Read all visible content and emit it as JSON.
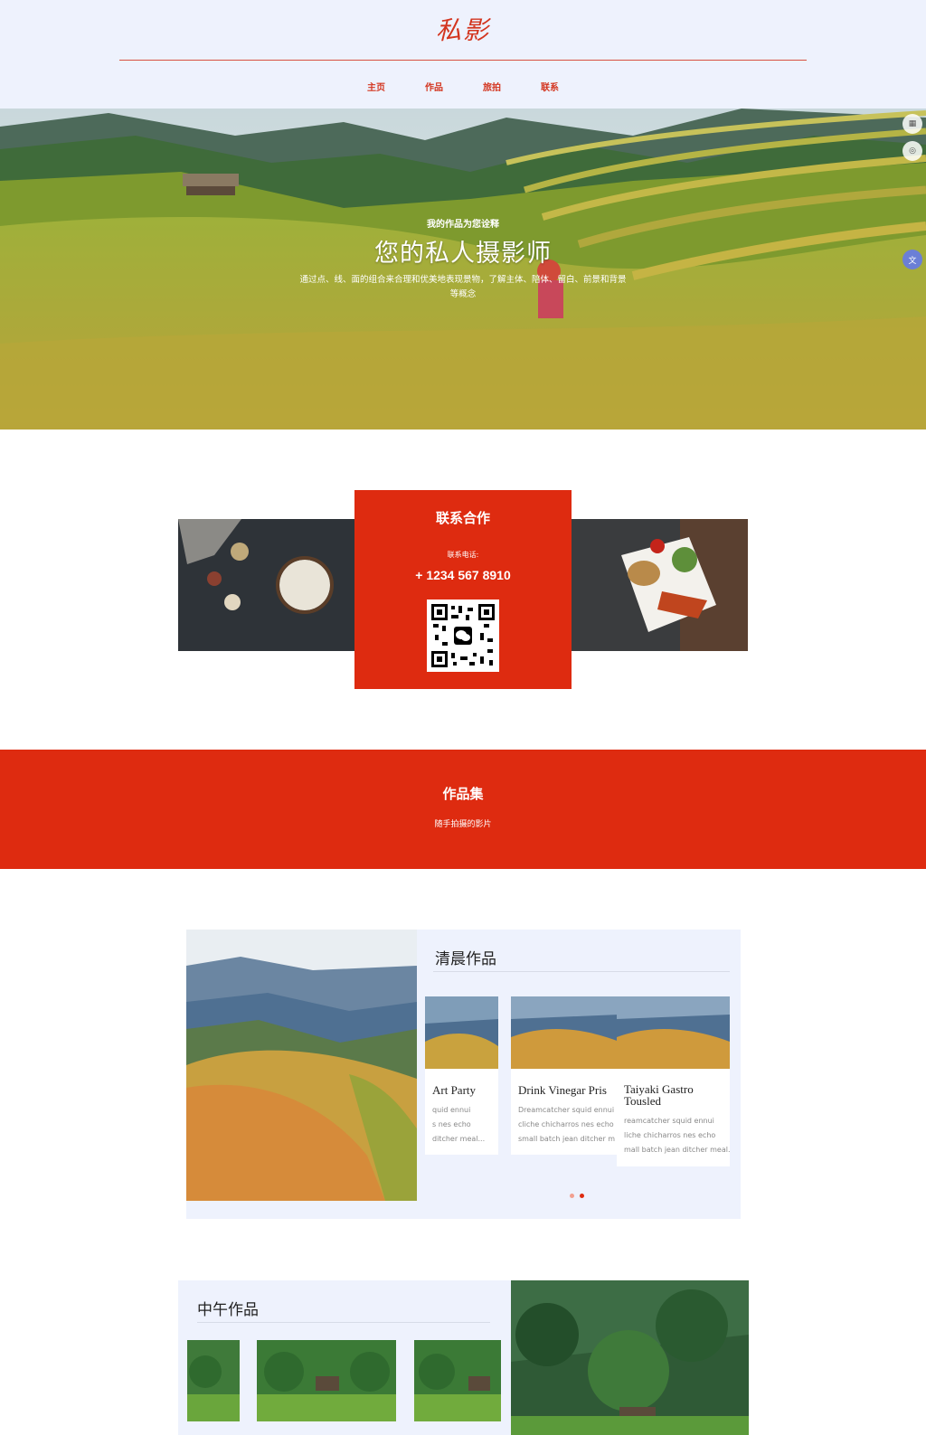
{
  "brand": "私影",
  "nav": [
    "主页",
    "作品",
    "旅拍",
    "联系"
  ],
  "hero": {
    "kicker": "我的作品为您诠释",
    "title": "您的私人摄影师",
    "description": "通过点、线、面的组合来合理和优美地表现景物，了解主体、陪体、留白、前景和背景等概念"
  },
  "contact": {
    "title": "联系合作",
    "phone_label": "联系电话:",
    "phone": "+ 1234 567 8910"
  },
  "works": {
    "title": "作品集",
    "subtitle": "随手拍摄的影片"
  },
  "morning": {
    "title": "清晨作品",
    "cards": [
      {
        "title": "Art Party",
        "lines": [
          "quid ennui",
          "s nes echo",
          "ditcher meal..."
        ]
      },
      {
        "title": "Drink Vinegar Pris",
        "lines": [
          "Dreamcatcher squid ennui",
          "cliche chicharros nes echo",
          "small batch jean ditcher m"
        ]
      },
      {
        "title": "Taiyaki Gastro Tousled",
        "lines": [
          "reamcatcher squid ennui",
          "liche chicharros nes echo",
          "mall batch jean ditcher meal..."
        ]
      }
    ]
  },
  "noon": {
    "title": "中午作品"
  },
  "colors": {
    "accent": "#de2b10",
    "header_bg": "#eef2fd"
  }
}
